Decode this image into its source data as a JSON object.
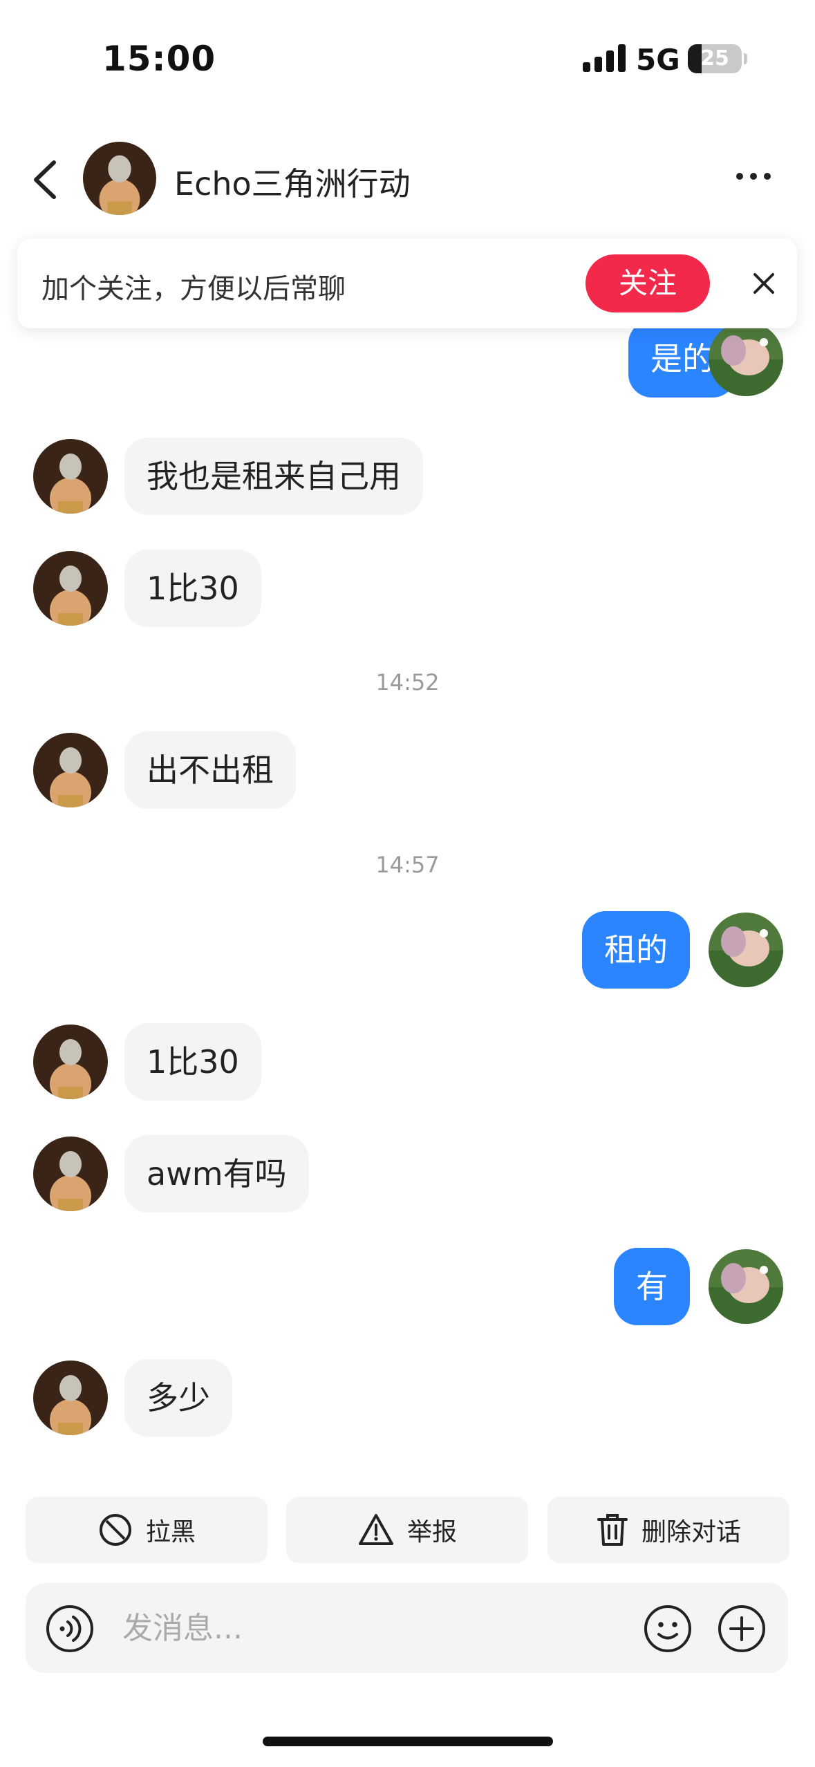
{
  "status_bar": {
    "time": "15:00",
    "network": "5G",
    "battery": "25",
    "battery_level": 0.25
  },
  "header": {
    "title": "Echo三角洲行动"
  },
  "follow_banner": {
    "text": "加个关注，方便以后常聊",
    "follow_label": "关注"
  },
  "messages": [
    {
      "side": "out",
      "text": "是的"
    },
    {
      "side": "in",
      "text": "我也是租来自己用"
    },
    {
      "side": "in",
      "text": "1比30"
    },
    {
      "side": "time",
      "text": "14:52"
    },
    {
      "side": "in",
      "text": "出不出租"
    },
    {
      "side": "time",
      "text": "14:57"
    },
    {
      "side": "out",
      "text": "租的"
    },
    {
      "side": "in",
      "text": "1比30"
    },
    {
      "side": "in",
      "text": "awm有吗"
    },
    {
      "side": "out",
      "text": "有"
    },
    {
      "side": "in",
      "text": "多少"
    }
  ],
  "actions": {
    "block": "拉黑",
    "report": "举报",
    "delete": "删除对话"
  },
  "input": {
    "placeholder": "发消息..."
  },
  "colors": {
    "accent_blue": "#2b85ff",
    "follow_red": "#f2294a",
    "bubble_gray": "#f4f4f4"
  }
}
